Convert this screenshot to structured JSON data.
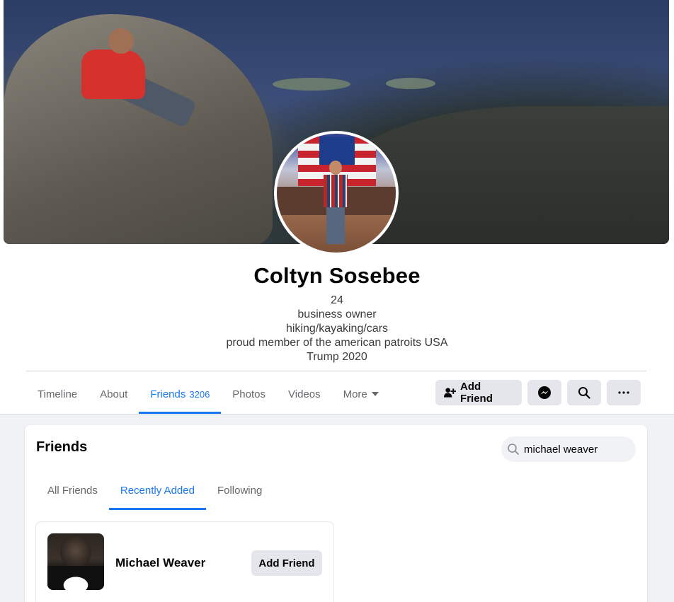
{
  "profile": {
    "name": "Coltyn Sosebee",
    "bio": [
      "24",
      "business owner",
      "hiking/kayaking/cars",
      "proud member of the american patroits USA",
      "Trump 2020"
    ]
  },
  "nav": {
    "tabs": [
      {
        "label": "Timeline"
      },
      {
        "label": "About"
      },
      {
        "label": "Friends",
        "count": "3206",
        "active": true
      },
      {
        "label": "Photos"
      },
      {
        "label": "Videos"
      },
      {
        "label": "More"
      }
    ]
  },
  "actions": {
    "add_friend_label": "Add Friend",
    "icons": [
      "add-friend-icon",
      "messenger-icon",
      "search-icon",
      "more-icon"
    ]
  },
  "friends_section": {
    "title": "Friends",
    "search_value": "michael weaver",
    "subtabs": [
      {
        "label": "All Friends"
      },
      {
        "label": "Recently Added",
        "active": true
      },
      {
        "label": "Following"
      }
    ],
    "results": [
      {
        "name": "Michael Weaver",
        "button_label": "Add Friend"
      }
    ]
  },
  "colors": {
    "accent": "#1877f2",
    "button_bg": "#e4e6eb",
    "page_bg": "#f0f2f5"
  }
}
